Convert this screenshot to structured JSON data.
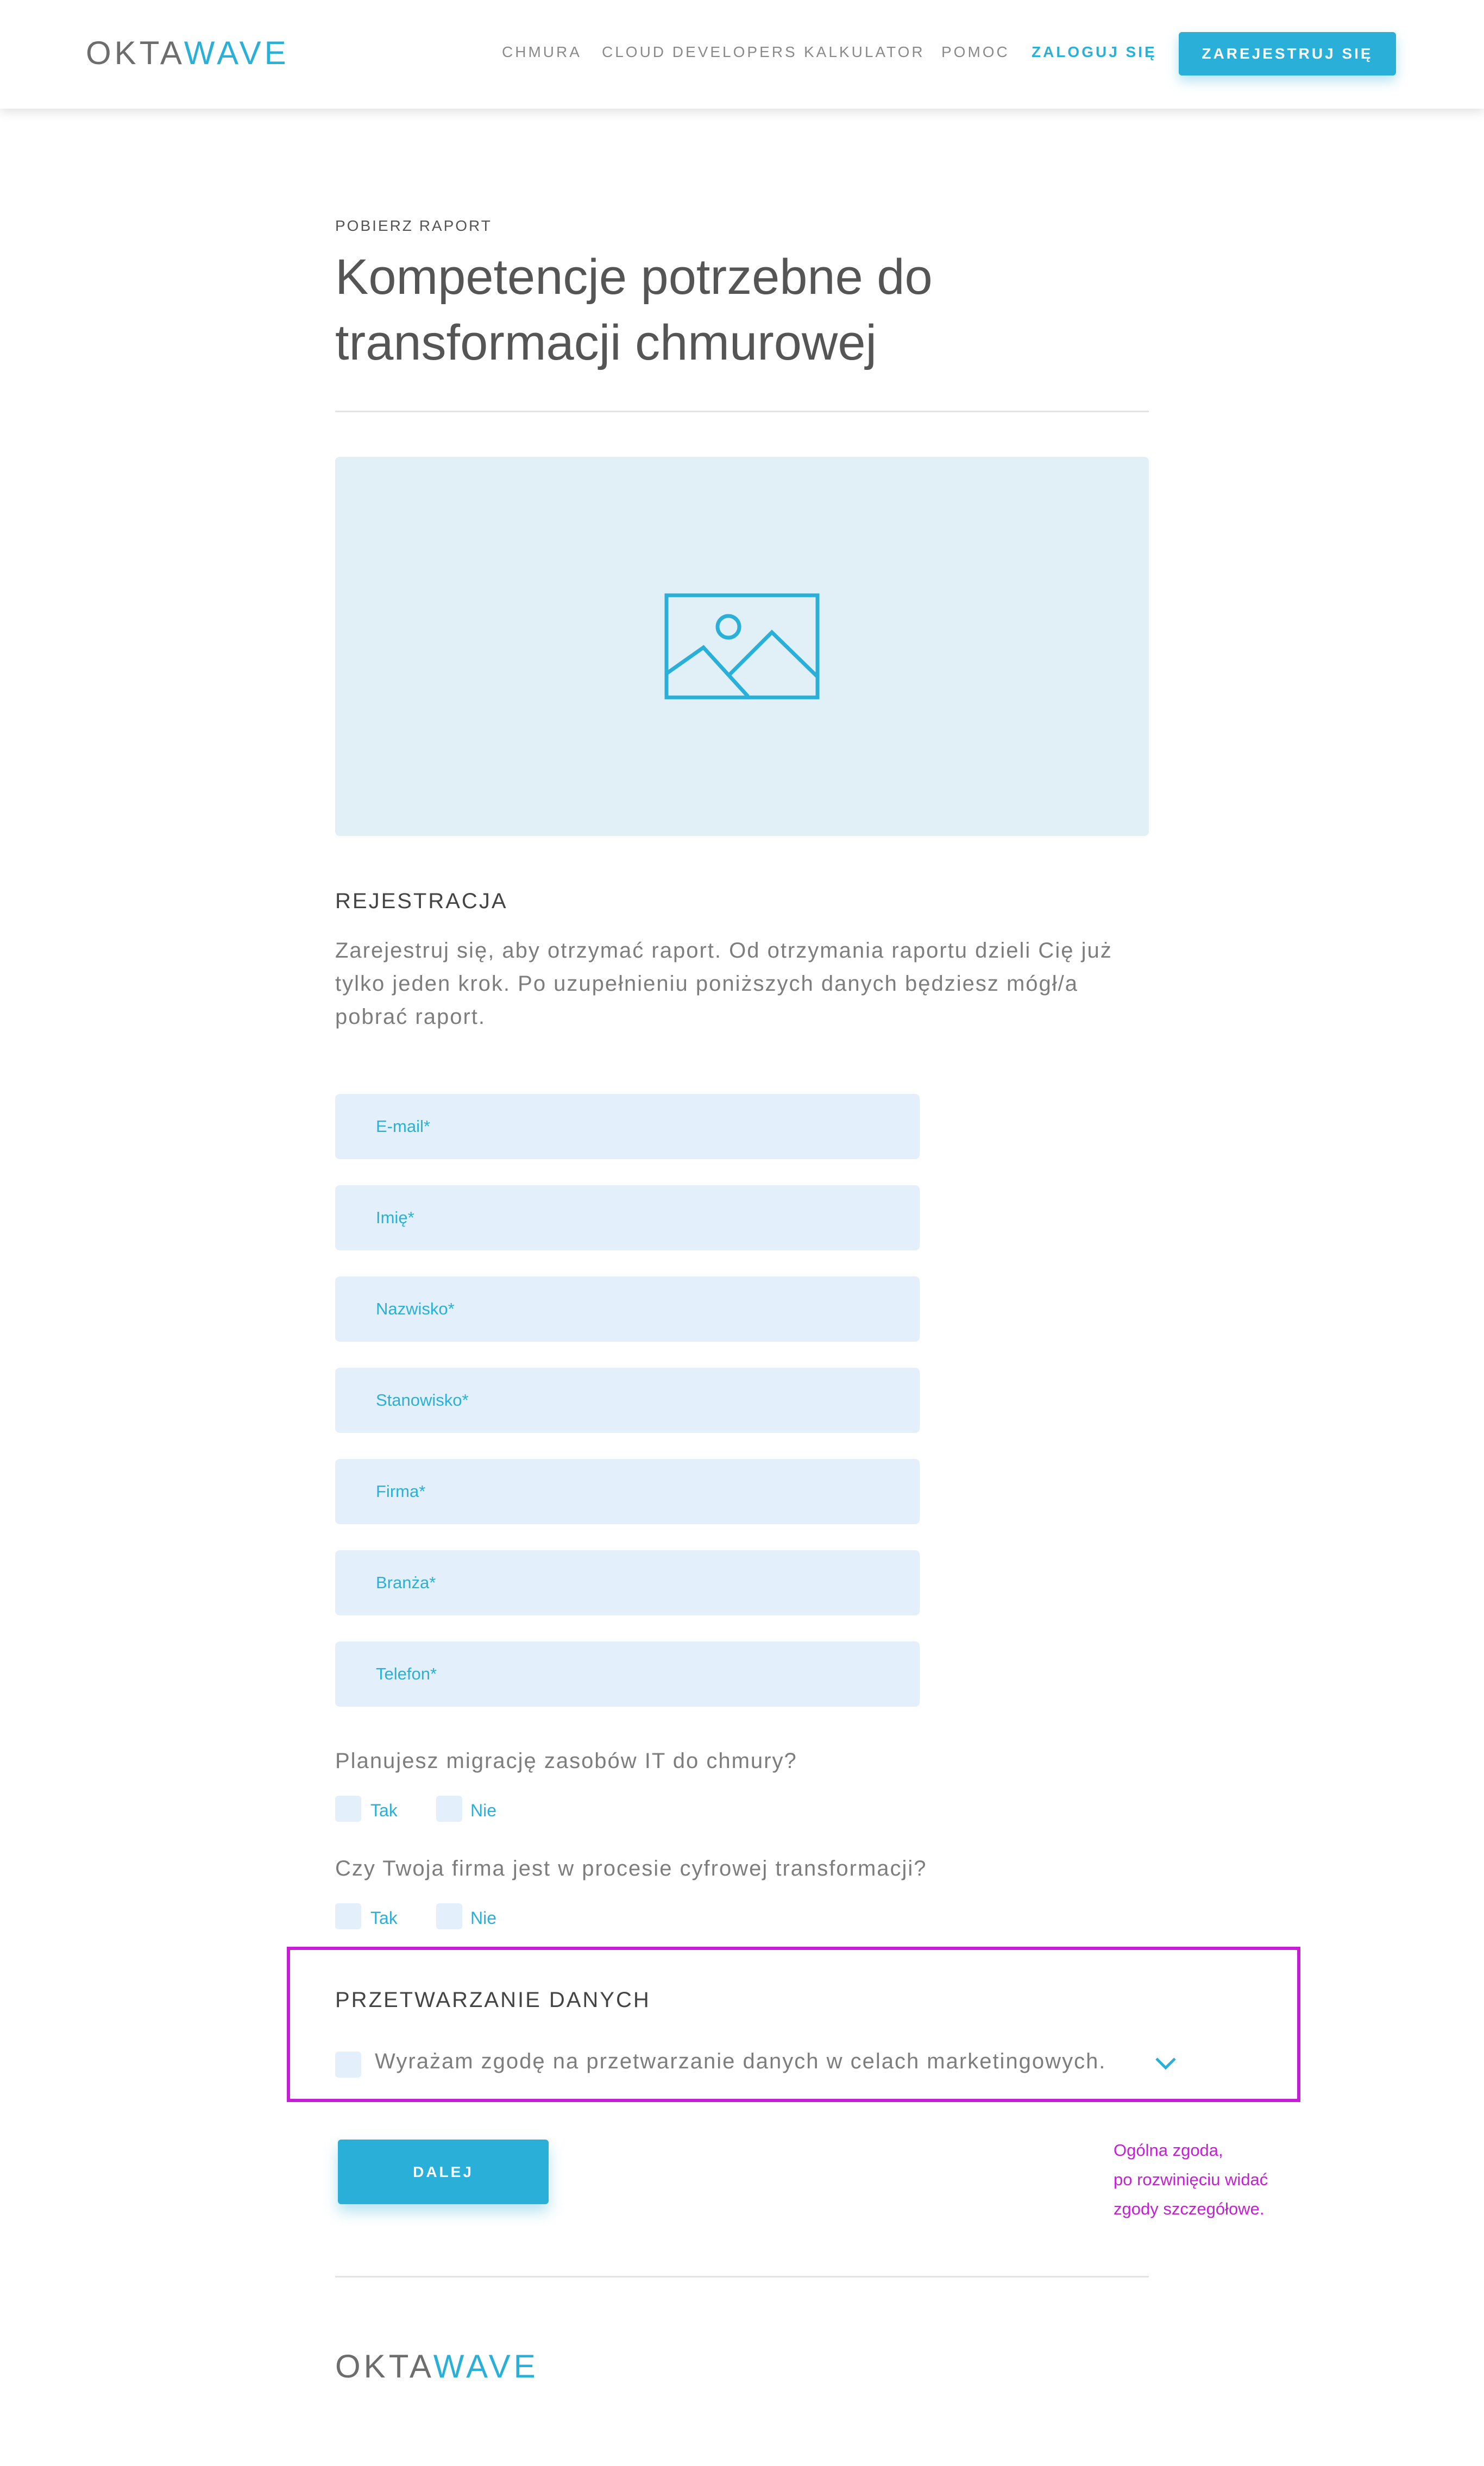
{
  "header": {
    "logo_left": "OKTA",
    "logo_right": "WAVE",
    "nav": [
      "CHMURA",
      "CLOUD DEVELOPERS",
      "KALKULATOR",
      "POMOC"
    ],
    "login_label": "ZALOGUJ SIĘ",
    "register_label": "ZAREJESTRUJ SIĘ"
  },
  "hero": {
    "eyebrow": "POBIERZ RAPORT",
    "title_line1": "Kompetencje potrzebne do",
    "title_line2": "transformacji chmurowej",
    "image_icon": "image-placeholder-icon"
  },
  "registration": {
    "heading": "REJESTRACJA",
    "lead_line1": "Zarejestruj się, aby otrzymać raport. Od otrzymania raportu dzieli Cię już",
    "lead_line2": "tylko jeden krok. Po uzupełnieniu poniższych danych będziesz mógł/a",
    "lead_line3": "pobrać raport.",
    "fields": {
      "email": "E-mail*",
      "first_name": "Imię*",
      "last_name": "Nazwisko*",
      "position": "Stanowisko*",
      "company": "Firma*",
      "industry": "Branża*",
      "phone": "Telefon*"
    }
  },
  "questions": [
    {
      "text": "Planujesz migrację zasobów IT do chmury?",
      "yes": "Tak",
      "no": "Nie"
    },
    {
      "text": "Czy Twoja firma jest w procesie cyfrowej transformacji?",
      "yes": "Tak",
      "no": "Nie"
    }
  ],
  "data_processing": {
    "heading": "PRZETWARZANIE DANYCH",
    "consent": "Wyrażam  zgodę na przetwarzanie danych w celach marketingowych."
  },
  "next_label": "DALEJ",
  "annotation": {
    "line1": "Ogólna zgoda,",
    "line2": "po rozwinięciu widać",
    "line3": "zgody szczegółowe."
  },
  "footer": {
    "logo_left": "OKTA",
    "logo_right": "WAVE"
  },
  "colors": {
    "accent": "#2ab0d8",
    "field_bg": "#e3f0fb",
    "hero_bg": "#e1eff7",
    "annotation": "#c61ed6",
    "text": "#6b6b6b"
  }
}
